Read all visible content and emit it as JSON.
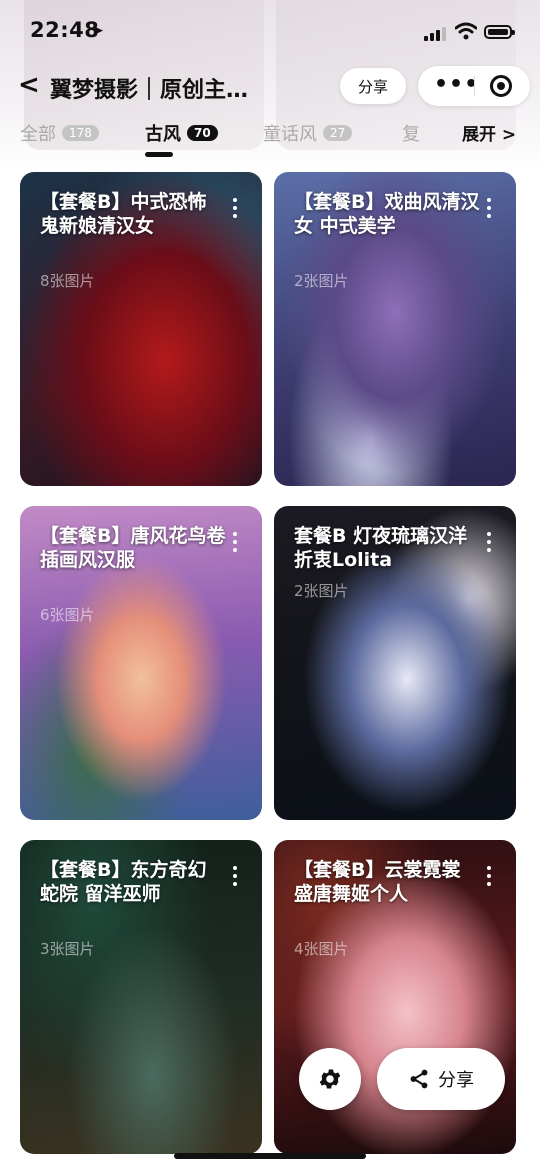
{
  "status": {
    "time": "22:48"
  },
  "nav": {
    "title": "翼梦摄影｜原创主…",
    "share_label": "分享"
  },
  "tabs": [
    {
      "label": "全部",
      "count": "178"
    },
    {
      "label": "古风",
      "count": "70"
    },
    {
      "label": "童话风",
      "count": "27"
    },
    {
      "label": "复",
      "count": ""
    }
  ],
  "expand_label": "展开 >",
  "cards": [
    {
      "title": "【套餐B】中式恐怖 鬼新娘清汉女",
      "count": "8张图片"
    },
    {
      "title": "【套餐B】戏曲风清汉女 中式美学",
      "count": "2张图片"
    },
    {
      "title": "【套餐B】唐风花鸟卷 插画风汉服",
      "count": "6张图片"
    },
    {
      "title": "套餐B 灯夜琉璃汉洋折衷Lolita",
      "count": "2张图片"
    },
    {
      "title": "【套餐B】东方奇幻 蛇院 留洋巫师",
      "count": "3张图片"
    },
    {
      "title": "【套餐B】云裳霓裳 盛唐舞姬个人",
      "count": "4张图片"
    }
  ],
  "fab": {
    "share_label": "分享"
  },
  "icons": {
    "back": "back-chevron-icon",
    "menu": "more-dots-icon",
    "close": "mini-program-close-icon",
    "settings": "gear-icon",
    "share": "share-icon"
  }
}
